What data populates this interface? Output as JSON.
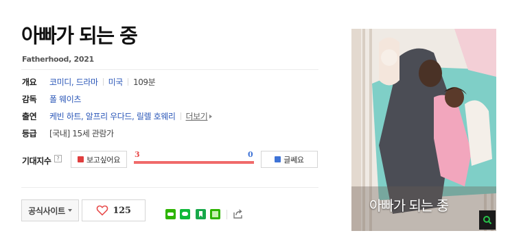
{
  "movie": {
    "title": "아빠가 되는 중",
    "subtitle": "Fatherhood, 2021"
  },
  "info": {
    "overview": {
      "label": "개요",
      "genre": "코미디, 드라마",
      "country": "미국",
      "runtime": "109분"
    },
    "director": {
      "label": "감독",
      "name": "폴 웨이츠"
    },
    "cast": {
      "label": "출연",
      "names": "케빈 하트, 알프리 우다드, 릴렐 호웨리",
      "more": "더보기"
    },
    "rating": {
      "label": "등급",
      "value": "[국내] 15세 관람가"
    }
  },
  "expectation": {
    "label": "기대지수",
    "help": "?",
    "want_label": "보고싶어요",
    "dislike_label": "글쎄요",
    "want_count": "3",
    "dislike_count": "0",
    "want_fraction": 1.0,
    "colors": {
      "want": "#f06a6a",
      "dislike": "#3f73d6"
    }
  },
  "actions": {
    "official_site": "공식사이트",
    "like_count": "125",
    "share_icons": [
      "band-icon",
      "line-icon",
      "bookmark-icon",
      "cafe-icon",
      "share-out-icon"
    ]
  },
  "poster": {
    "title_text": "아빠가 되는 중"
  }
}
